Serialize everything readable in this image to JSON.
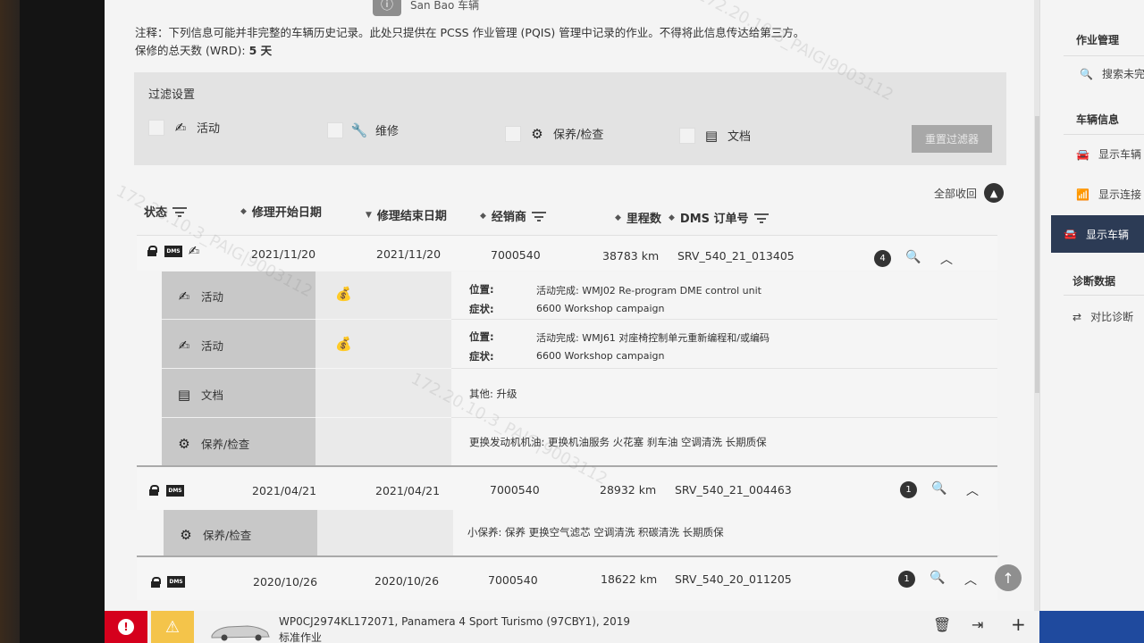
{
  "top_badge": {
    "text": "San Bao 车辆"
  },
  "note": {
    "line1": "注释：下列信息可能并非完整的车辆历史记录。此处只提供在 PCSS 作业管理 (PQIS) 管理中记录的作业。不得将此信息传达给第三方。",
    "wrd_label": "保修的总天数 (WRD): ",
    "wrd_value": "5 天"
  },
  "filter": {
    "title": "过滤设置",
    "items": [
      {
        "label": "活动",
        "icon": "campaign-icon"
      },
      {
        "label": "维修",
        "icon": "wrench-icon"
      },
      {
        "label": "保养/检查",
        "icon": "gear-icon"
      },
      {
        "label": "文档",
        "icon": "document-icon"
      }
    ],
    "reset_label": "重置过滤器"
  },
  "collapse_all_label": "全部收回",
  "headers": {
    "status": "状态",
    "start_date": "修理开始日期",
    "end_date": "修理结束日期",
    "dealer": "经销商",
    "mileage": "里程数",
    "dms_order": "DMS 订单号"
  },
  "rows": [
    {
      "start": "2021/11/20",
      "end": "2021/11/20",
      "dealer": "7000540",
      "mileage": "38783 km",
      "order": "SRV_540_21_013405",
      "count": "4",
      "dms": "DMS"
    },
    {
      "start": "2021/04/21",
      "end": "2021/04/21",
      "dealer": "7000540",
      "mileage": "28932 km",
      "order": "SRV_540_21_004463",
      "count": "1",
      "dms": "DMS"
    },
    {
      "start": "2020/10/26",
      "end": "2020/10/26",
      "dealer": "7000540",
      "mileage": "18622 km",
      "order": "SRV_540_20_011205",
      "count": "1",
      "dms": "DMS"
    }
  ],
  "details1": [
    {
      "type": "活动",
      "loc_label": "位置:",
      "loc_value": "活动完成:  WMJ02 Re-program DME control unit",
      "sym_label": "症状:",
      "sym_value": "6600 Workshop campaign"
    },
    {
      "type": "活动",
      "loc_label": "位置:",
      "loc_value": "活动完成:  WMJ61 对座椅控制单元重新编程和/或编码",
      "sym_label": "症状:",
      "sym_value": "6600 Workshop campaign"
    },
    {
      "type": "文档",
      "text": "其他: 升级"
    },
    {
      "type": "保养/检查",
      "text": "更换发动机机油: 更换机油服务 火花塞 刹车油 空调清洗 长期质保"
    }
  ],
  "details2": [
    {
      "type": "保养/检查",
      "text": "小保养: 保养 更换空气滤芯 空调清洗 积碳清洗 长期质保"
    }
  ],
  "watermark": "172.20.10.3_PAIG|9003112",
  "sidebar": {
    "sections": [
      "作业管理",
      "车辆信息",
      "诊断数据"
    ],
    "items": [
      "搜索未完",
      "显示车辆",
      "显示连接",
      "显示车辆",
      "对比诊断"
    ]
  },
  "bottom": {
    "vehicle_line1": "WP0CJ2974KL172071, Panamera 4 Sport Turismo (97CBY1), 2019",
    "vehicle_line2": "标准作业"
  }
}
